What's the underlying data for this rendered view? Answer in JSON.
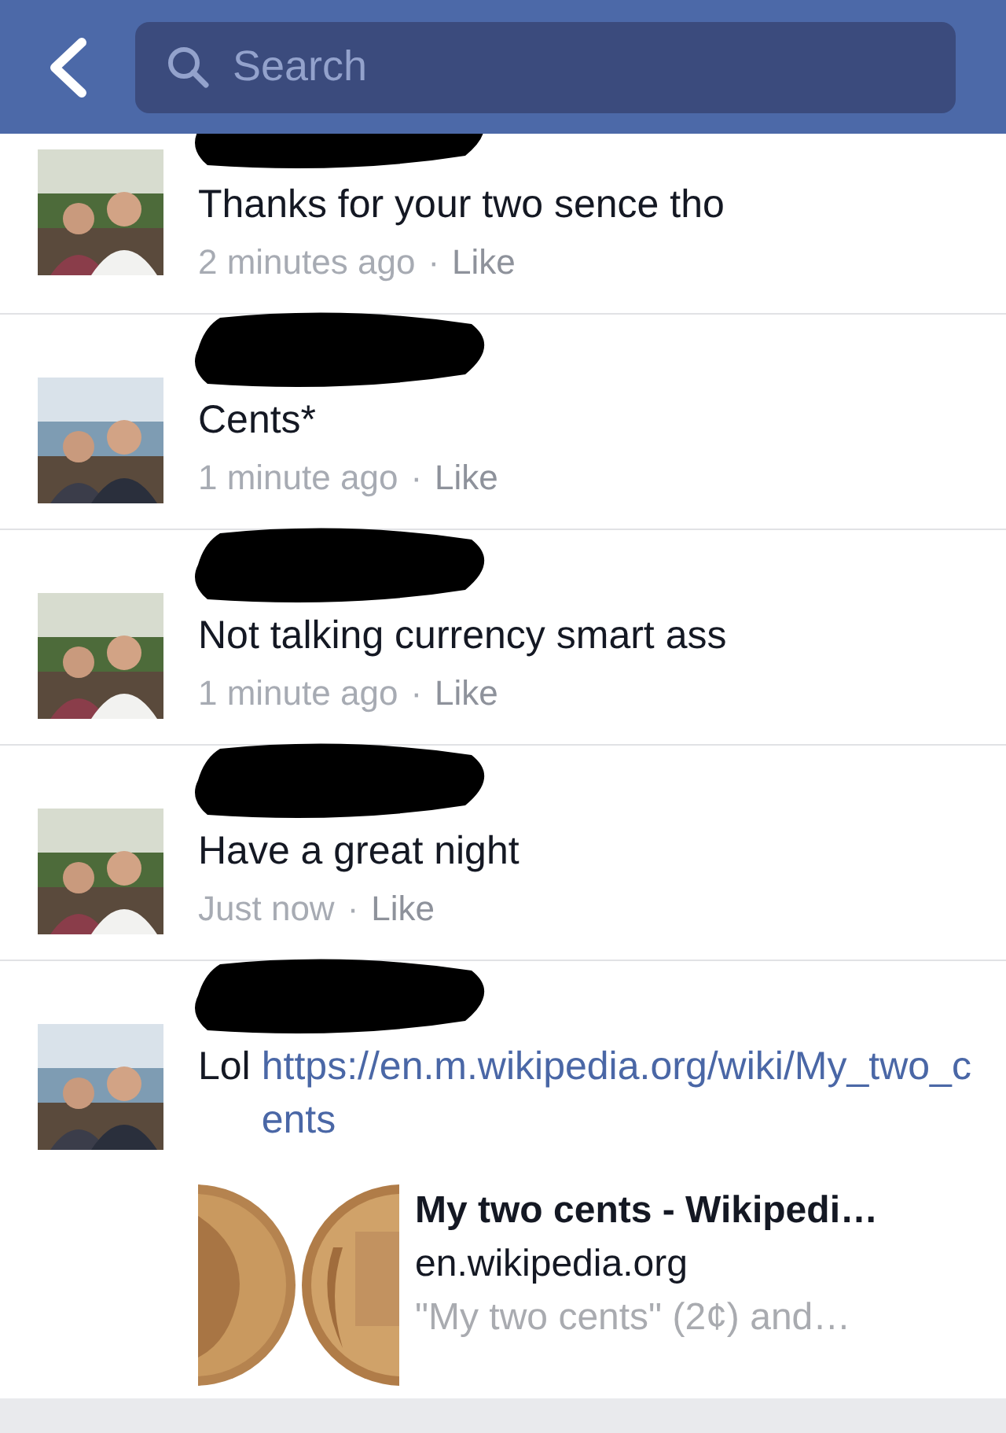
{
  "header": {
    "search": {
      "placeholder": "Search"
    }
  },
  "comments": [
    {
      "body": "Thanks for your two sence tho",
      "time": "2 minutes ago",
      "dot": "·",
      "like": "Like"
    },
    {
      "body": "Cents*",
      "time": "1 minute ago",
      "dot": "·",
      "like": "Like"
    },
    {
      "body": "Not talking currency smart ass",
      "time": "1 minute ago",
      "dot": "·",
      "like": "Like"
    },
    {
      "body": "Have a great night",
      "time": "Just now",
      "dot": "·",
      "like": "Like"
    },
    {
      "body": "Lol",
      "link": "https://en.m.wikipedia.org/wiki/My_two_cents",
      "preview": {
        "title": "My two cents - Wikipedi…",
        "domain": "en.wikipedia.org",
        "snippet": "\"My two cents\" (2¢) and…"
      }
    }
  ]
}
